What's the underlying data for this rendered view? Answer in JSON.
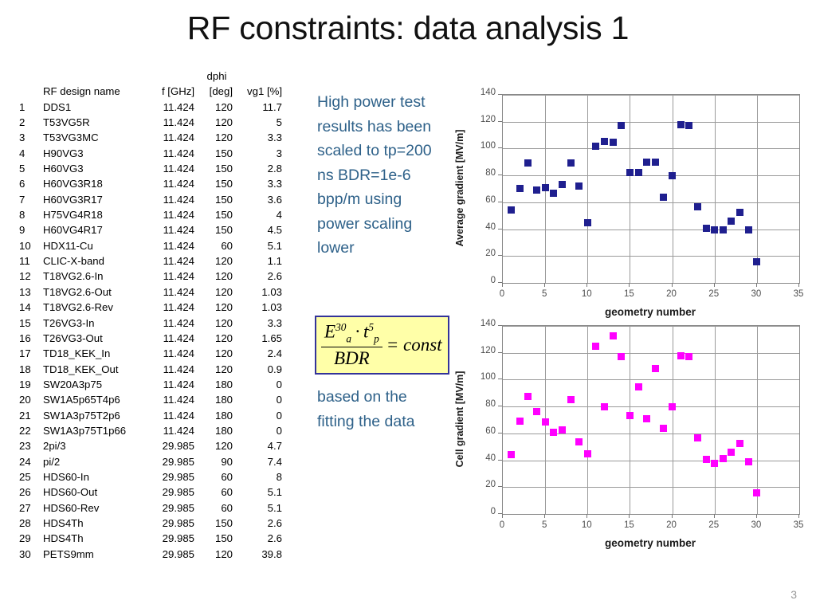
{
  "slide": {
    "title": "RF constraints: data analysis 1",
    "page_number": "3"
  },
  "table": {
    "header_dphi": "dphi",
    "columns": [
      "",
      "RF design name",
      "f [GHz]",
      "[deg]",
      "vg1 [%]"
    ],
    "rows": [
      {
        "idx": "1",
        "name": "DDS1",
        "f": "11.424",
        "dphi": "120",
        "vg1": "11.7"
      },
      {
        "idx": "2",
        "name": "T53VG5R",
        "f": "11.424",
        "dphi": "120",
        "vg1": "5"
      },
      {
        "idx": "3",
        "name": "T53VG3MC",
        "f": "11.424",
        "dphi": "120",
        "vg1": "3.3"
      },
      {
        "idx": "4",
        "name": "H90VG3",
        "f": "11.424",
        "dphi": "150",
        "vg1": "3"
      },
      {
        "idx": "5",
        "name": "H60VG3",
        "f": "11.424",
        "dphi": "150",
        "vg1": "2.8"
      },
      {
        "idx": "6",
        "name": "H60VG3R18",
        "f": "11.424",
        "dphi": "150",
        "vg1": "3.3"
      },
      {
        "idx": "7",
        "name": "H60VG3R17",
        "f": "11.424",
        "dphi": "150",
        "vg1": "3.6"
      },
      {
        "idx": "8",
        "name": "H75VG4R18",
        "f": "11.424",
        "dphi": "150",
        "vg1": "4"
      },
      {
        "idx": "9",
        "name": "H60VG4R17",
        "f": "11.424",
        "dphi": "150",
        "vg1": "4.5"
      },
      {
        "idx": "10",
        "name": "HDX11-Cu",
        "f": "11.424",
        "dphi": "60",
        "vg1": "5.1"
      },
      {
        "idx": "11",
        "name": "CLIC-X-band",
        "f": "11.424",
        "dphi": "120",
        "vg1": "1.1"
      },
      {
        "idx": "12",
        "name": "T18VG2.6-In",
        "f": "11.424",
        "dphi": "120",
        "vg1": "2.6"
      },
      {
        "idx": "13",
        "name": "T18VG2.6-Out",
        "f": "11.424",
        "dphi": "120",
        "vg1": "1.03"
      },
      {
        "idx": "14",
        "name": "T18VG2.6-Rev",
        "f": "11.424",
        "dphi": "120",
        "vg1": "1.03"
      },
      {
        "idx": "15",
        "name": "T26VG3-In",
        "f": "11.424",
        "dphi": "120",
        "vg1": "3.3"
      },
      {
        "idx": "16",
        "name": "T26VG3-Out",
        "f": "11.424",
        "dphi": "120",
        "vg1": "1.65"
      },
      {
        "idx": "17",
        "name": "TD18_KEK_In",
        "f": "11.424",
        "dphi": "120",
        "vg1": "2.4"
      },
      {
        "idx": "18",
        "name": "TD18_KEK_Out",
        "f": "11.424",
        "dphi": "120",
        "vg1": "0.9"
      },
      {
        "idx": "19",
        "name": "SW20A3p75",
        "f": "11.424",
        "dphi": "180",
        "vg1": "0"
      },
      {
        "idx": "20",
        "name": "SW1A5p65T4p6",
        "f": "11.424",
        "dphi": "180",
        "vg1": "0"
      },
      {
        "idx": "21",
        "name": "SW1A3p75T2p6",
        "f": "11.424",
        "dphi": "180",
        "vg1": "0"
      },
      {
        "idx": "22",
        "name": "SW1A3p75T1p66",
        "f": "11.424",
        "dphi": "180",
        "vg1": "0"
      },
      {
        "idx": "23",
        "name": "2pi/3",
        "f": "29.985",
        "dphi": "120",
        "vg1": "4.7"
      },
      {
        "idx": "24",
        "name": "pi/2",
        "f": "29.985",
        "dphi": "90",
        "vg1": "7.4"
      },
      {
        "idx": "25",
        "name": "HDS60-In",
        "f": "29.985",
        "dphi": "60",
        "vg1": "8"
      },
      {
        "idx": "26",
        "name": "HDS60-Out",
        "f": "29.985",
        "dphi": "60",
        "vg1": "5.1"
      },
      {
        "idx": "27",
        "name": "HDS60-Rev",
        "f": "29.985",
        "dphi": "60",
        "vg1": "5.1"
      },
      {
        "idx": "28",
        "name": "HDS4Th",
        "f": "29.985",
        "dphi": "150",
        "vg1": "2.6"
      },
      {
        "idx": "29",
        "name": "HDS4Th",
        "f": "29.985",
        "dphi": "150",
        "vg1": "2.6"
      },
      {
        "idx": "30",
        "name": "PETS9mm",
        "f": "29.985",
        "dphi": "120",
        "vg1": "39.8"
      }
    ]
  },
  "notes": {
    "paragraph_1": "High power test results has been scaled to tp=200 ns BDR=1e-6 bpp/m using power scaling lower",
    "paragraph_2": "based on the fitting the data"
  },
  "formula": {
    "numerator_base_1": "E",
    "numerator_sup_1": "30",
    "numerator_sub_1": "a",
    "dot": "·",
    "numerator_base_2": "t",
    "numerator_sup_2": "5",
    "numerator_sub_2": "p",
    "denominator": "BDR",
    "equals_const": "= const",
    "fill_color": "#FFFFA8",
    "border_color": "#333399"
  },
  "chart_data": [
    {
      "id": "average-gradient",
      "type": "scatter",
      "title": "",
      "xlabel": "geometry number",
      "ylabel": "Average gradient [MV/m]",
      "xlim": [
        0,
        35
      ],
      "ylim": [
        0,
        140
      ],
      "xticks": [
        0,
        5,
        10,
        15,
        20,
        25,
        30,
        35
      ],
      "yticks": [
        0,
        20,
        40,
        60,
        80,
        100,
        120,
        140
      ],
      "grid": true,
      "legend": "none",
      "marker_color": "#1f1f8f",
      "marker_shape": "square",
      "x": [
        1,
        2,
        3,
        4,
        5,
        6,
        7,
        8,
        9,
        10,
        11,
        12,
        13,
        14,
        15,
        16,
        17,
        18,
        19,
        20,
        21,
        22,
        23,
        24,
        25,
        26,
        27,
        28,
        29,
        30
      ],
      "y": [
        54,
        70.5,
        89,
        69,
        71,
        66.5,
        73.5,
        89,
        72,
        44.5,
        102,
        105.5,
        105,
        117,
        82,
        82,
        90,
        90,
        63.5,
        79.5,
        118,
        117,
        56.5,
        40.5,
        39.5,
        39.5,
        46,
        52.5,
        39.5,
        16
      ]
    },
    {
      "id": "cell-gradient",
      "type": "scatter",
      "title": "",
      "xlabel": "geometry number",
      "ylabel": "Cell gradient [MV/m]",
      "xlim": [
        0,
        35
      ],
      "ylim": [
        0,
        140
      ],
      "xticks": [
        0,
        5,
        10,
        15,
        20,
        25,
        30,
        35
      ],
      "yticks": [
        0,
        20,
        40,
        60,
        80,
        100,
        120,
        140
      ],
      "grid": true,
      "legend": "none",
      "marker_color": "#FF00FF",
      "marker_shape": "square",
      "x": [
        1,
        2,
        3,
        4,
        5,
        6,
        7,
        8,
        9,
        10,
        11,
        12,
        13,
        14,
        15,
        16,
        17,
        18,
        19,
        20,
        21,
        22,
        23,
        24,
        25,
        26,
        27,
        28,
        29,
        30
      ],
      "y": [
        44,
        69,
        87.5,
        76,
        68.5,
        61,
        62.5,
        85,
        53.5,
        44.5,
        125,
        80,
        132.5,
        117,
        73.5,
        94.5,
        71,
        108,
        63.5,
        79.5,
        118,
        117,
        56.5,
        40.5,
        37.5,
        41,
        46,
        52.5,
        39,
        16
      ]
    }
  ]
}
